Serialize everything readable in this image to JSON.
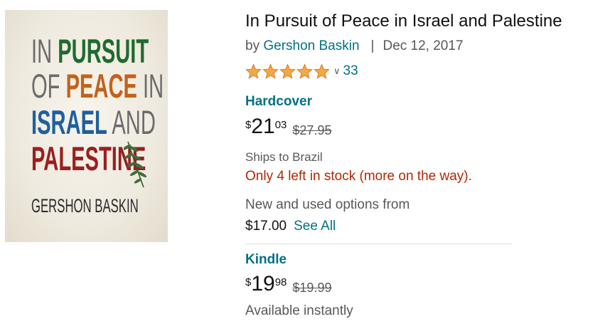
{
  "cover": {
    "line1_a": "IN ",
    "line1_b": "PURSUIT",
    "line2_a": "OF ",
    "line2_b": "PEACE",
    "line2_c": " IN",
    "line3_a": "ISRAEL",
    "line3_b": " AND",
    "line4": "PALESTINE",
    "author": "GERSHON BASKIN"
  },
  "product": {
    "title": "In Pursuit of Peace in Israel and Palestine",
    "by": "by",
    "author": "Gershon Baskin",
    "separator": "|",
    "date": "Dec 12, 2017",
    "rating_stars": 5,
    "rating_count": "33"
  },
  "hardcover": {
    "label": "Hardcover",
    "currency": "$",
    "price_whole": "21",
    "price_frac": "03",
    "list_price": "$27.95",
    "ships_to": "Ships to Brazil",
    "stock": "Only 4 left in stock (more on the way).",
    "used_text": "New and used options from",
    "used_price": "$17.00",
    "see_all": "See All"
  },
  "kindle": {
    "label": "Kindle",
    "currency": "$",
    "price_whole": "19",
    "price_frac": "98",
    "list_price": "$19.99",
    "availability": "Available instantly"
  },
  "colors": {
    "link": "#007185",
    "star": "#f3a847",
    "stock": "#b12704"
  }
}
